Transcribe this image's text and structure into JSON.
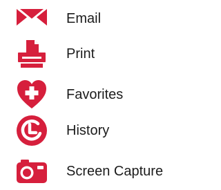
{
  "theme": {
    "accent": "#d61f3c",
    "text": "#1c1c1c",
    "background": "#ffffff"
  },
  "menu": {
    "items": [
      {
        "label": "Email",
        "icon": "email-icon"
      },
      {
        "label": "Print",
        "icon": "printer-icon"
      },
      {
        "label": "Favorites",
        "icon": "heart-plus-icon"
      },
      {
        "label": "History",
        "icon": "history-clock-icon"
      },
      {
        "label": "Screen Capture",
        "icon": "camera-icon"
      }
    ]
  }
}
